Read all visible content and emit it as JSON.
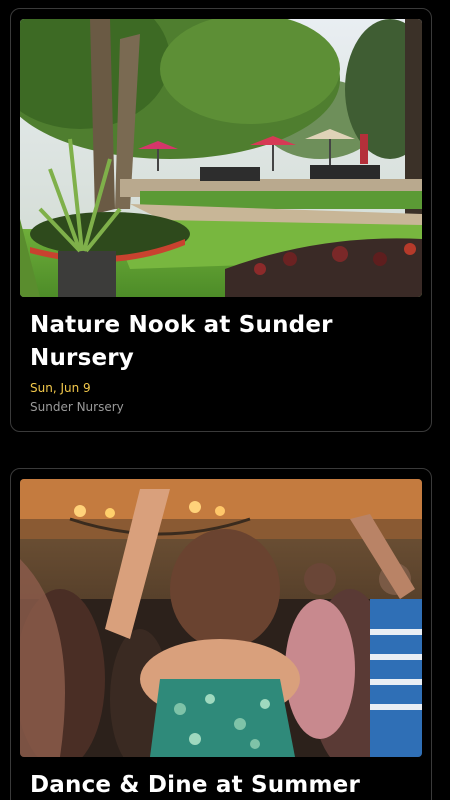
{
  "events": [
    {
      "title": "Nature Nook at Sunder Nursery",
      "date": "Sun, Jun 9",
      "venue": "Sunder Nursery",
      "image": "garden-photo"
    },
    {
      "title": "Dance & Dine at Summer",
      "image": "dance-party-photo"
    }
  ],
  "colors": {
    "background": "#000000",
    "card_border": "#3a3a3a",
    "date": "#f2c84b",
    "venue": "#9a9a9a",
    "title": "#ffffff"
  }
}
